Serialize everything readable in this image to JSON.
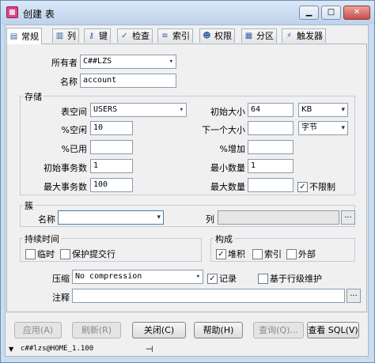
{
  "window": {
    "title": "创建 表",
    "minimize": "▁",
    "maximize": "□",
    "close": "✕"
  },
  "tabs": [
    {
      "label": "常规",
      "icon": "general-icon",
      "glyph": "▤"
    },
    {
      "label": "列",
      "icon": "columns-icon",
      "glyph": "▥"
    },
    {
      "label": "键",
      "icon": "key-icon",
      "glyph": "⚷"
    },
    {
      "label": "检查",
      "icon": "check-icon",
      "glyph": "✓"
    },
    {
      "label": "索引",
      "icon": "index-icon",
      "glyph": "≡"
    },
    {
      "label": "权限",
      "icon": "users-icon",
      "glyph": "☻"
    },
    {
      "label": "分区",
      "icon": "partition-icon",
      "glyph": "▦"
    },
    {
      "label": "触发器",
      "icon": "trigger-icon",
      "glyph": "⚡"
    }
  ],
  "general": {
    "owner_label": "所有者",
    "owner_value": "C##LZS",
    "name_label": "名称",
    "name_value": "account"
  },
  "storage": {
    "title": "存储",
    "tablespace_label": "表空间",
    "tablespace_value": "USERS",
    "pct_free_label": "%空闲",
    "pct_free_value": "10",
    "pct_used_label": "%已用",
    "pct_used_value": "",
    "initrans_label": "初始事务数",
    "initrans_value": "1",
    "maxtrans_label": "最大事务数",
    "maxtrans_value": "100",
    "initial_label": "初始大小",
    "initial_value": "64",
    "initial_unit": "KB",
    "next_label": "下一个大小",
    "next_value": "",
    "next_unit": "字节",
    "pct_increase_label": "%增加",
    "pct_increase_value": "",
    "minextents_label": "最小数量",
    "minextents_value": "1",
    "maxextents_label": "最大数量",
    "maxextents_value": "",
    "unlimited_label": "不限制",
    "unlimited_checked": "✓"
  },
  "cluster": {
    "title": "簇",
    "name_label": "名称",
    "name_value": "",
    "columns_label": "列",
    "columns_value": "",
    "ellipsis": "..."
  },
  "duration": {
    "title": "持续时间",
    "temporary_label": "临时",
    "temporary_checked": "",
    "preserve_label": "保护提交行",
    "preserve_checked": ""
  },
  "organization": {
    "title": "构成",
    "heap_label": "堆积",
    "heap_checked": "✓",
    "index_label": "索引",
    "index_checked": "",
    "external_label": "外部",
    "external_checked": ""
  },
  "compression": {
    "label": "压缩",
    "value": "No compression"
  },
  "logging": {
    "label": "记录",
    "checked": "✓"
  },
  "row_movement": {
    "label": "基于行级维护",
    "checked": ""
  },
  "comment": {
    "label": "注释",
    "value": "",
    "ellipsis": "..."
  },
  "buttons": {
    "apply": "应用(A)",
    "refresh": "刷新(R)",
    "close": "关闭(C)",
    "help": "帮助(H)",
    "query": "查询(Q)...",
    "view_sql": "查看 SQL(V)"
  },
  "status": {
    "connection": "c##lzs@HOME_1.100",
    "pin": "⊣"
  }
}
